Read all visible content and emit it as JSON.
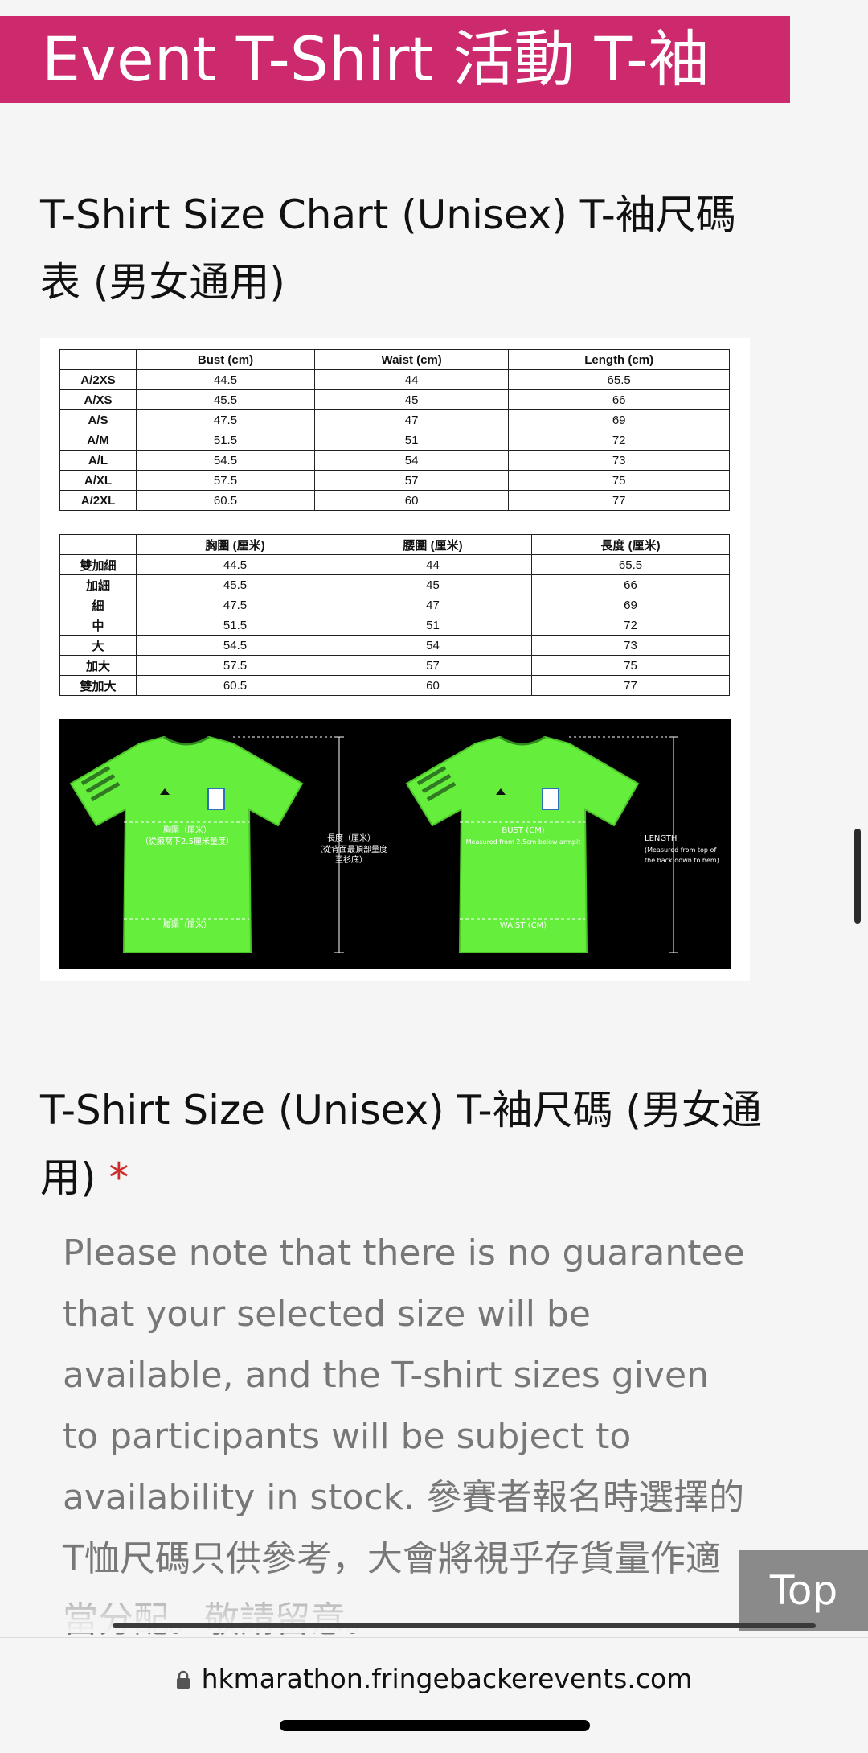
{
  "banner": {
    "title": "Event T-Shirt 活動 T-袖"
  },
  "chart_section": {
    "title": "T-Shirt Size Chart (Unisex) T-袖尺碼表 (男女通用)"
  },
  "table_en": {
    "headers": [
      "",
      "Bust (cm)",
      "Waist (cm)",
      "Length (cm)"
    ],
    "rows": [
      [
        "A/2XS",
        "44.5",
        "44",
        "65.5"
      ],
      [
        "A/XS",
        "45.5",
        "45",
        "66"
      ],
      [
        "A/S",
        "47.5",
        "47",
        "69"
      ],
      [
        "A/M",
        "51.5",
        "51",
        "72"
      ],
      [
        "A/L",
        "54.5",
        "54",
        "73"
      ],
      [
        "A/XL",
        "57.5",
        "57",
        "75"
      ],
      [
        "A/2XL",
        "60.5",
        "60",
        "77"
      ]
    ]
  },
  "table_zh": {
    "headers": [
      "",
      "胸圍 (厘米)",
      "腰圍 (厘米)",
      "長度 (厘米)"
    ],
    "rows": [
      [
        "雙加細",
        "44.5",
        "44",
        "65.5"
      ],
      [
        "加細",
        "45.5",
        "45",
        "66"
      ],
      [
        "細",
        "47.5",
        "47",
        "69"
      ],
      [
        "中",
        "51.5",
        "51",
        "72"
      ],
      [
        "大",
        "54.5",
        "54",
        "73"
      ],
      [
        "加大",
        "57.5",
        "57",
        "75"
      ],
      [
        "雙加大",
        "60.5",
        "60",
        "77"
      ]
    ]
  },
  "shirt_image": {
    "zh": {
      "bust": "胸圍（厘米）",
      "bust_note": "（從腋窩下2.5厘米量度）",
      "waist": "腰圍（厘米）",
      "length": "長度（厘米）",
      "length_note": "（從背面最頂部量度至衫底）"
    },
    "en": {
      "bust": "BUST (CM)",
      "bust_note": "Measured from 2.5cm below armpit",
      "waist": "WAIST (CM)",
      "length": "LENGTH",
      "length_note": "(Measured from top of the back down to hem)"
    },
    "shirt_color": "#66ee3c"
  },
  "size_section": {
    "title": "T-Shirt Size (Unisex) T-袖尺碼 (男女通用)",
    "required_mark": "*",
    "note": "Please note that there is no guarantee that your selected size will be available, and the T-shirt sizes given to participants will be subject to availability in stock. 參賽者報名時選擇的T恤尺碼只供參考，大會將視乎存貨量作適當分配。敬請留意。"
  },
  "top_button": {
    "label": "Top"
  },
  "browser": {
    "url": "hkmarathon.fringebackerevents.com"
  },
  "colors": {
    "banner": "#cd2a6e",
    "required": "#cd2a2a",
    "note_text": "#777777"
  }
}
